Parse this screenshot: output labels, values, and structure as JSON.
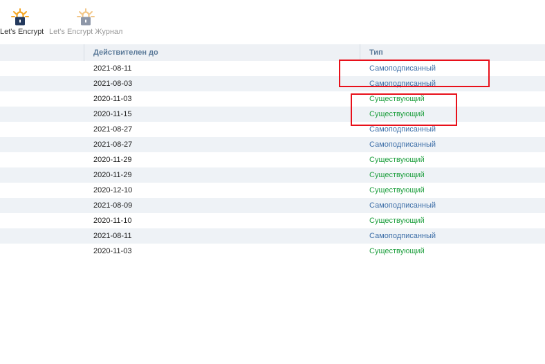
{
  "toolbar": {
    "letsencrypt_label": "Let's Encrypt",
    "letsencrypt_log_label": "Let's Encrypt Журнал"
  },
  "table": {
    "columns": {
      "valid_until": "Действителен до",
      "type": "Тип"
    },
    "rows": [
      {
        "valid_until": "2021-08-11",
        "type": "Самоподписанный",
        "kind": "self"
      },
      {
        "valid_until": "2021-08-03",
        "type": "Самоподписанный",
        "kind": "self"
      },
      {
        "valid_until": "2020-11-03",
        "type": "Существующий",
        "kind": "existing"
      },
      {
        "valid_until": "2020-11-15",
        "type": "Существующий",
        "kind": "existing"
      },
      {
        "valid_until": "2021-08-27",
        "type": "Самоподписанный",
        "kind": "self"
      },
      {
        "valid_until": "2021-08-27",
        "type": "Самоподписанный",
        "kind": "self"
      },
      {
        "valid_until": "2020-11-29",
        "type": "Существующий",
        "kind": "existing"
      },
      {
        "valid_until": "2020-11-29",
        "type": "Существующий",
        "kind": "existing"
      },
      {
        "valid_until": "2020-12-10",
        "type": "Существующий",
        "kind": "existing"
      },
      {
        "valid_until": "2021-08-09",
        "type": "Самоподписанный",
        "kind": "self"
      },
      {
        "valid_until": "2020-11-10",
        "type": "Существующий",
        "kind": "existing"
      },
      {
        "valid_until": "2021-08-11",
        "type": "Самоподписанный",
        "kind": "self"
      },
      {
        "valid_until": "2020-11-03",
        "type": "Существующий",
        "kind": "existing"
      }
    ]
  },
  "colors": {
    "self_signed": "#3e6fa8",
    "existing": "#20a040",
    "highlight": "#e8101a",
    "header_text": "#5b7a99"
  },
  "icons": {
    "letsencrypt": "lock-sun-icon",
    "letsencrypt_log": "lock-sun-icon"
  }
}
